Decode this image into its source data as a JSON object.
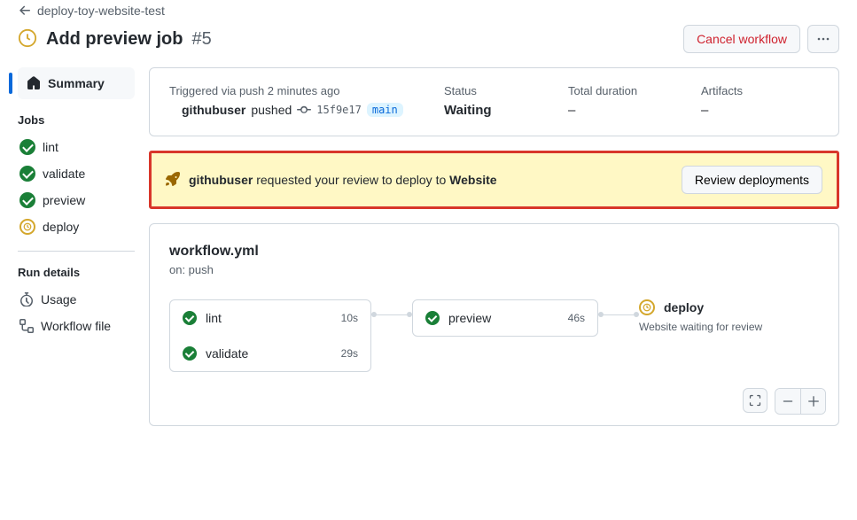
{
  "nav": {
    "back_label": "deploy-toy-website-test",
    "title": "Add preview job",
    "run_number": "#5",
    "cancel_label": "Cancel workflow"
  },
  "sidebar": {
    "summary_label": "Summary",
    "jobs_heading": "Jobs",
    "jobs": [
      {
        "name": "lint",
        "status": "success"
      },
      {
        "name": "validate",
        "status": "success"
      },
      {
        "name": "preview",
        "status": "success"
      },
      {
        "name": "deploy",
        "status": "waiting"
      }
    ],
    "run_details_heading": "Run details",
    "usage_label": "Usage",
    "workflow_file_label": "Workflow file"
  },
  "meta": {
    "triggered_text": "Triggered via push 2 minutes ago",
    "actor": "githubuser",
    "pushed_word": "pushed",
    "commit_sha": "15f9e17",
    "branch": "main",
    "status_label": "Status",
    "status_value": "Waiting",
    "duration_label": "Total duration",
    "duration_value": "–",
    "artifacts_label": "Artifacts",
    "artifacts_value": "–"
  },
  "banner": {
    "actor": "githubuser",
    "mid_text": "requested your review to deploy to",
    "target": "Website",
    "button_label": "Review deployments"
  },
  "workflow": {
    "file": "workflow.yml",
    "trigger": "on: push",
    "stages": {
      "box1": [
        {
          "name": "lint",
          "time": "10s"
        },
        {
          "name": "validate",
          "time": "29s"
        }
      ],
      "box2": [
        {
          "name": "preview",
          "time": "46s"
        }
      ],
      "deploy": {
        "name": "deploy",
        "subtext": "Website waiting for review"
      }
    }
  }
}
